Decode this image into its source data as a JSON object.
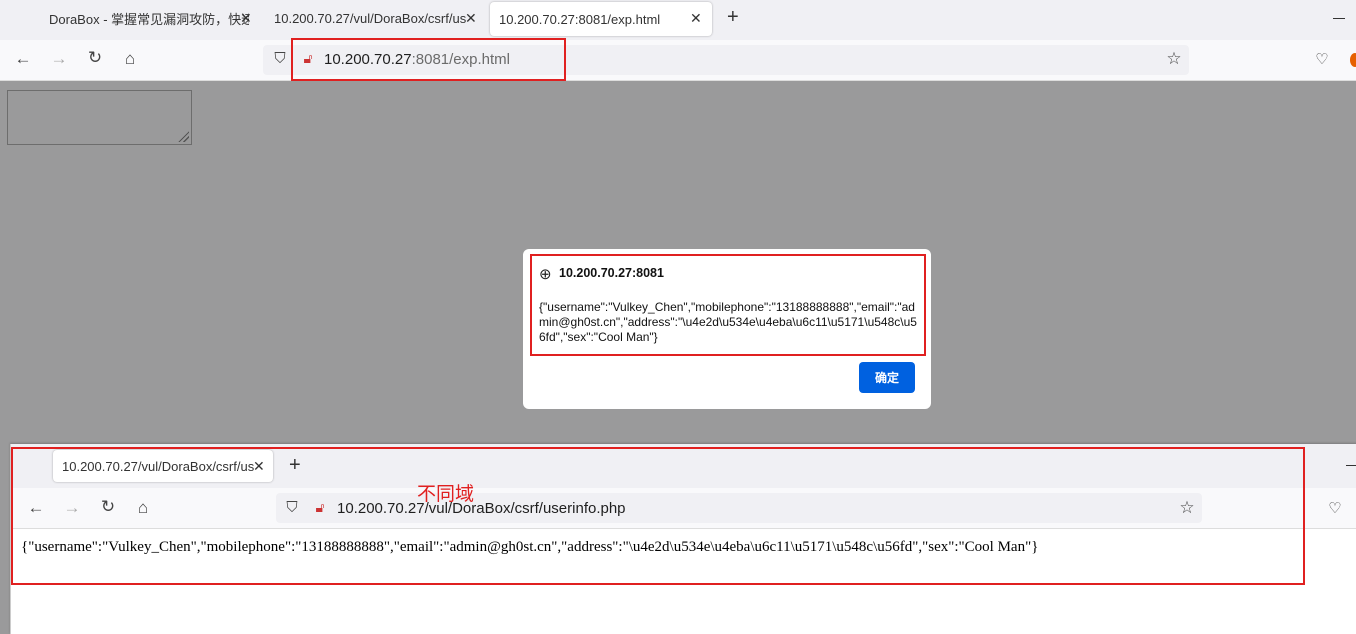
{
  "browser_main": {
    "tabs": [
      {
        "label": "DoraBox - 掌握常见漏洞攻防，快速",
        "active": false
      },
      {
        "label": "10.200.70.27/vul/DoraBox/csrf/us",
        "active": false
      },
      {
        "label": "10.200.70.27:8081/exp.html",
        "active": true
      }
    ],
    "url_host": "10.200.70.27",
    "url_rest": ":8081/exp.html"
  },
  "alert_dialog": {
    "origin": "10.200.70.27:8081",
    "message": "{\"username\":\"Vulkey_Chen\",\"mobilephone\":\"13188888888\",\"email\":\"admin@gh0st.cn\",\"address\":\"\\u4e2d\\u534e\\u4eba\\u6c11\\u5171\\u548c\\u56fd\",\"sex\":\"Cool Man\"}",
    "ok_label": "确定"
  },
  "browser_second": {
    "tabs": [
      {
        "label": "10.200.70.27/vul/DoraBox/csrf/us",
        "active": true
      }
    ],
    "url_host": "10.200.70.27",
    "url_rest": "/vul/DoraBox/csrf/userinfo.php",
    "page_text": "{\"username\":\"Vulkey_Chen\",\"mobilephone\":\"13188888888\",\"email\":\"admin@gh0st.cn\",\"address\":\"\\u4e2d\\u534e\\u4eba\\u6c11\\u5171\\u548c\\u56fd\",\"sex\":\"Cool Man\"}"
  },
  "annotation": {
    "text": "不同域",
    "color": "#e02020"
  },
  "colors": {
    "accent": "#0061e0",
    "highlight": "#e02020",
    "overlay": "#9a9a9b"
  }
}
